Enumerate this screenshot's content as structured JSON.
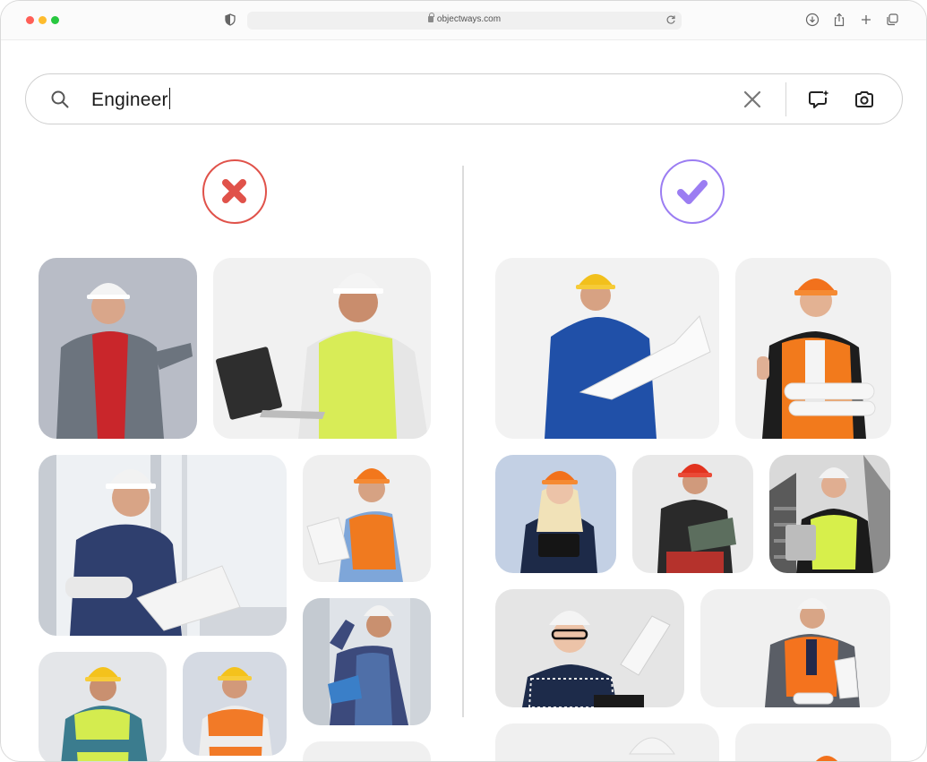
{
  "browser": {
    "url": "objectways.com"
  },
  "search": {
    "query": "Engineer"
  },
  "comparison": {
    "rejected": {
      "icon": "x-mark-icon",
      "color": "#e0524a"
    },
    "approved": {
      "icon": "check-mark-icon",
      "color": "#9b7df2"
    }
  },
  "tile_icons": "photo-of-engineer"
}
